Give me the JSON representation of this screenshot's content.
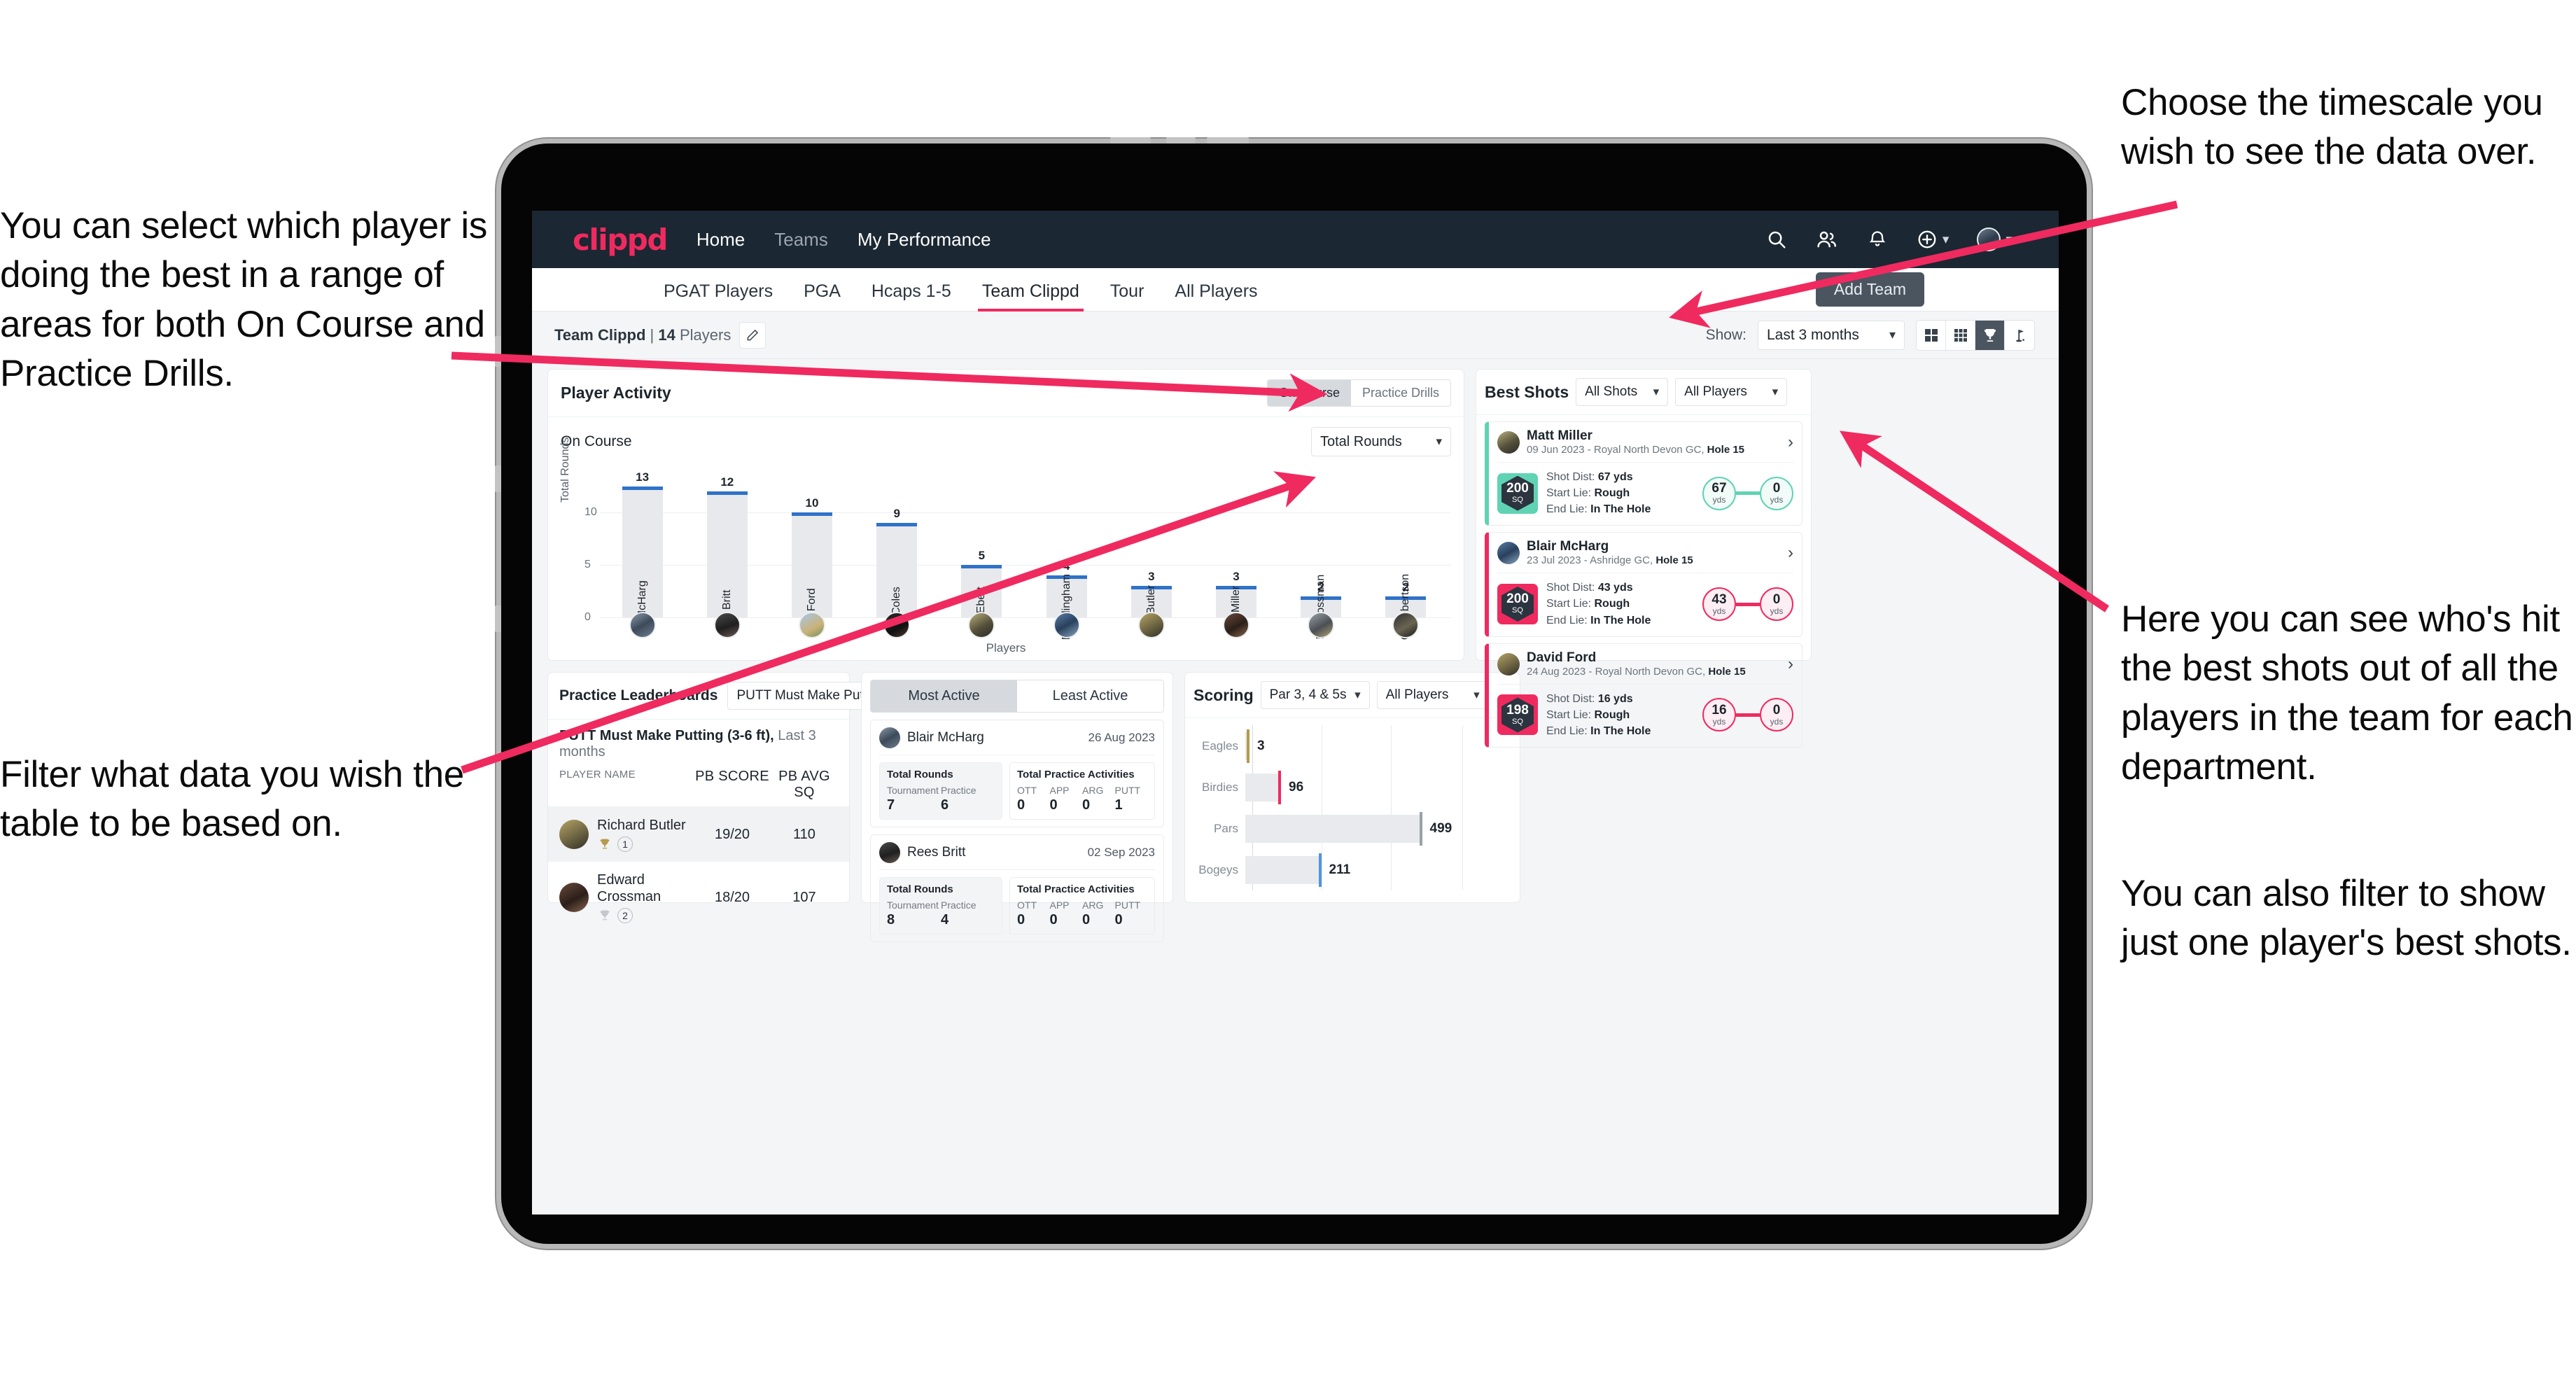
{
  "annotations": {
    "left_top": "You can select which player is doing the best in a range of areas for both On Course and Practice Drills.",
    "left_bottom": "Filter what data you wish the table to be based on.",
    "right_top": "Choose the timescale you wish to see the data over.",
    "right_mid": "Here you can see who's hit the best shots out of all the players in the team for each department.",
    "right_bottom": "You can also filter to show just one player's best shots."
  },
  "colors": {
    "brand": "#ef2a5f",
    "navy": "#1b2733",
    "blue": "#2f72c9",
    "teal": "#5fd3b4",
    "gold": "#b59a4d"
  },
  "appbar": {
    "logo": "clippd",
    "links": [
      {
        "label": "Home",
        "dim": false
      },
      {
        "label": "Teams",
        "dim": true
      },
      {
        "label": "My Performance",
        "dim": false
      }
    ],
    "icons": [
      "search-icon",
      "people-icon",
      "bell-icon",
      "plus-circle-icon",
      "avatar"
    ]
  },
  "tabs": [
    {
      "label": "PGAT Players",
      "active": false
    },
    {
      "label": "PGA",
      "active": false
    },
    {
      "label": "Hcaps 1-5",
      "active": false
    },
    {
      "label": "Team Clippd",
      "active": true
    },
    {
      "label": "Tour",
      "active": false
    },
    {
      "label": "All Players",
      "active": false
    }
  ],
  "add_team_button": "Add Team",
  "toolbar": {
    "team_name": "Team Clippd",
    "separator": "|",
    "player_count": "14",
    "players_word": "Players",
    "edit_icon": "pencil-icon",
    "show_label": "Show:",
    "show_value": "Last 3 months",
    "view_toggles": [
      {
        "icon": "grid-2x2-icon",
        "active": false
      },
      {
        "icon": "grid-3x3-icon",
        "active": false
      },
      {
        "icon": "trophy-icon",
        "active": true
      },
      {
        "icon": "golf-flag-icon",
        "active": false
      }
    ]
  },
  "player_activity": {
    "title": "Player Activity",
    "segments": [
      {
        "label": "On Course",
        "active": true
      },
      {
        "label": "Practice Drills",
        "active": false
      }
    ],
    "subtitle": "On Course",
    "metric_select": "Total Rounds"
  },
  "best_shots": {
    "title": "Best Shots",
    "filter_shots": "All Shots",
    "filter_players": "All Players",
    "cards": [
      {
        "name": "Matt Miller",
        "meta_date": "09 Jun 2023",
        "meta_sep": " - ",
        "meta_course": "Royal North Devon GC, ",
        "meta_hole": "Hole 15",
        "sq": "200",
        "sq_unit": "SQ",
        "accent": "#5fd3b4",
        "shot_dist_label": "Shot Dist: ",
        "shot_dist": "67 yds",
        "start_lie_label": "Start Lie: ",
        "start_lie": "Rough",
        "end_lie_label": "End Lie: ",
        "end_lie": "In The Hole",
        "from_val": "67",
        "from_unit": "yds",
        "to_val": "0",
        "to_unit": "yds"
      },
      {
        "name": "Blair McHarg",
        "meta_date": "23 Jul 2023",
        "meta_sep": " - ",
        "meta_course": "Ashridge GC, ",
        "meta_hole": "Hole 15",
        "sq": "200",
        "sq_unit": "SQ",
        "accent": "#ef2a5f",
        "shot_dist_label": "Shot Dist: ",
        "shot_dist": "43 yds",
        "start_lie_label": "Start Lie: ",
        "start_lie": "Rough",
        "end_lie_label": "End Lie: ",
        "end_lie": "In The Hole",
        "from_val": "43",
        "from_unit": "yds",
        "to_val": "0",
        "to_unit": "yds"
      },
      {
        "name": "David Ford",
        "meta_date": "24 Aug 2023",
        "meta_sep": " - ",
        "meta_course": "Royal North Devon GC, ",
        "meta_hole": "Hole 15",
        "sq": "198",
        "sq_unit": "SQ",
        "accent": "#ef2a5f",
        "shot_dist_label": "Shot Dist: ",
        "shot_dist": "16 yds",
        "start_lie_label": "Start Lie: ",
        "start_lie": "Rough",
        "end_lie_label": "End Lie: ",
        "end_lie": "In The Hole",
        "from_val": "16",
        "from_unit": "yds",
        "to_val": "0",
        "to_unit": "yds"
      }
    ]
  },
  "practice_leaderboards": {
    "title": "Practice Leaderboards",
    "select": "PUTT Must Make Putting ...",
    "subtitle_bold": "PUTT Must Make Putting (3-6 ft),",
    "subtitle_light": " Last 3 months",
    "columns": [
      "PLAYER NAME",
      "PB SCORE",
      "PB AVG SQ"
    ],
    "rows": [
      {
        "name": "Richard Butler",
        "rank": "1",
        "trophy": "gold",
        "pb_score": "19/20",
        "pb_avg_sq": "110",
        "highlight": true
      },
      {
        "name": "Edward Crossman",
        "rank": "2",
        "trophy": "silver",
        "pb_score": "18/20",
        "pb_avg_sq": "107",
        "highlight": false
      }
    ]
  },
  "activity_panel": {
    "tabs": [
      {
        "label": "Most Active",
        "active": true
      },
      {
        "label": "Least Active",
        "active": false
      }
    ],
    "rounds_title": "Total Rounds",
    "practice_title": "Total Practice Activities",
    "rounds_keys": [
      "Tournament",
      "Practice"
    ],
    "practice_keys": [
      "OTT",
      "APP",
      "ARG",
      "PUTT"
    ],
    "cards": [
      {
        "name": "Blair McHarg",
        "date": "26 Aug 2023",
        "rounds": [
          "7",
          "6"
        ],
        "practice": [
          "0",
          "0",
          "0",
          "1"
        ]
      },
      {
        "name": "Rees Britt",
        "date": "02 Sep 2023",
        "rounds": [
          "8",
          "4"
        ],
        "practice": [
          "0",
          "0",
          "0",
          "0"
        ]
      }
    ]
  },
  "scoring": {
    "title": "Scoring",
    "filter_par": "Par 3, 4 & 5s",
    "filter_players": "All Players"
  },
  "chart_data": [
    {
      "type": "bar",
      "title": "Player Activity - On Course",
      "xlabel": "Players",
      "ylabel": "Total Rounds",
      "ylim": [
        0,
        14
      ],
      "yticks": [
        0,
        5,
        10
      ],
      "grid": true,
      "categories": [
        "B. McHarg",
        "R. Britt",
        "D. Ford",
        "J. Coles",
        "E. Ebert",
        "D. Billingham",
        "R. Butler",
        "M. Miller",
        "E. Crossman",
        "C. Robertson"
      ],
      "values": [
        13,
        12,
        10,
        9,
        5,
        4,
        3,
        3,
        2,
        2
      ],
      "bar_color": "#e7e9ec",
      "cap_color": "#2f72c9"
    },
    {
      "type": "bar",
      "orientation": "horizontal",
      "title": "Scoring",
      "xlabel": "",
      "ylabel": "",
      "grid": true,
      "xlim": [
        0,
        600
      ],
      "categories": [
        "Eagles",
        "Birdies",
        "Pars",
        "Bogeys"
      ],
      "values": [
        3,
        96,
        499,
        211
      ],
      "cap_colors": [
        "#b59a4d",
        "#ef2a5f",
        "#9aa1a8",
        "#4f95e0"
      ]
    }
  ]
}
